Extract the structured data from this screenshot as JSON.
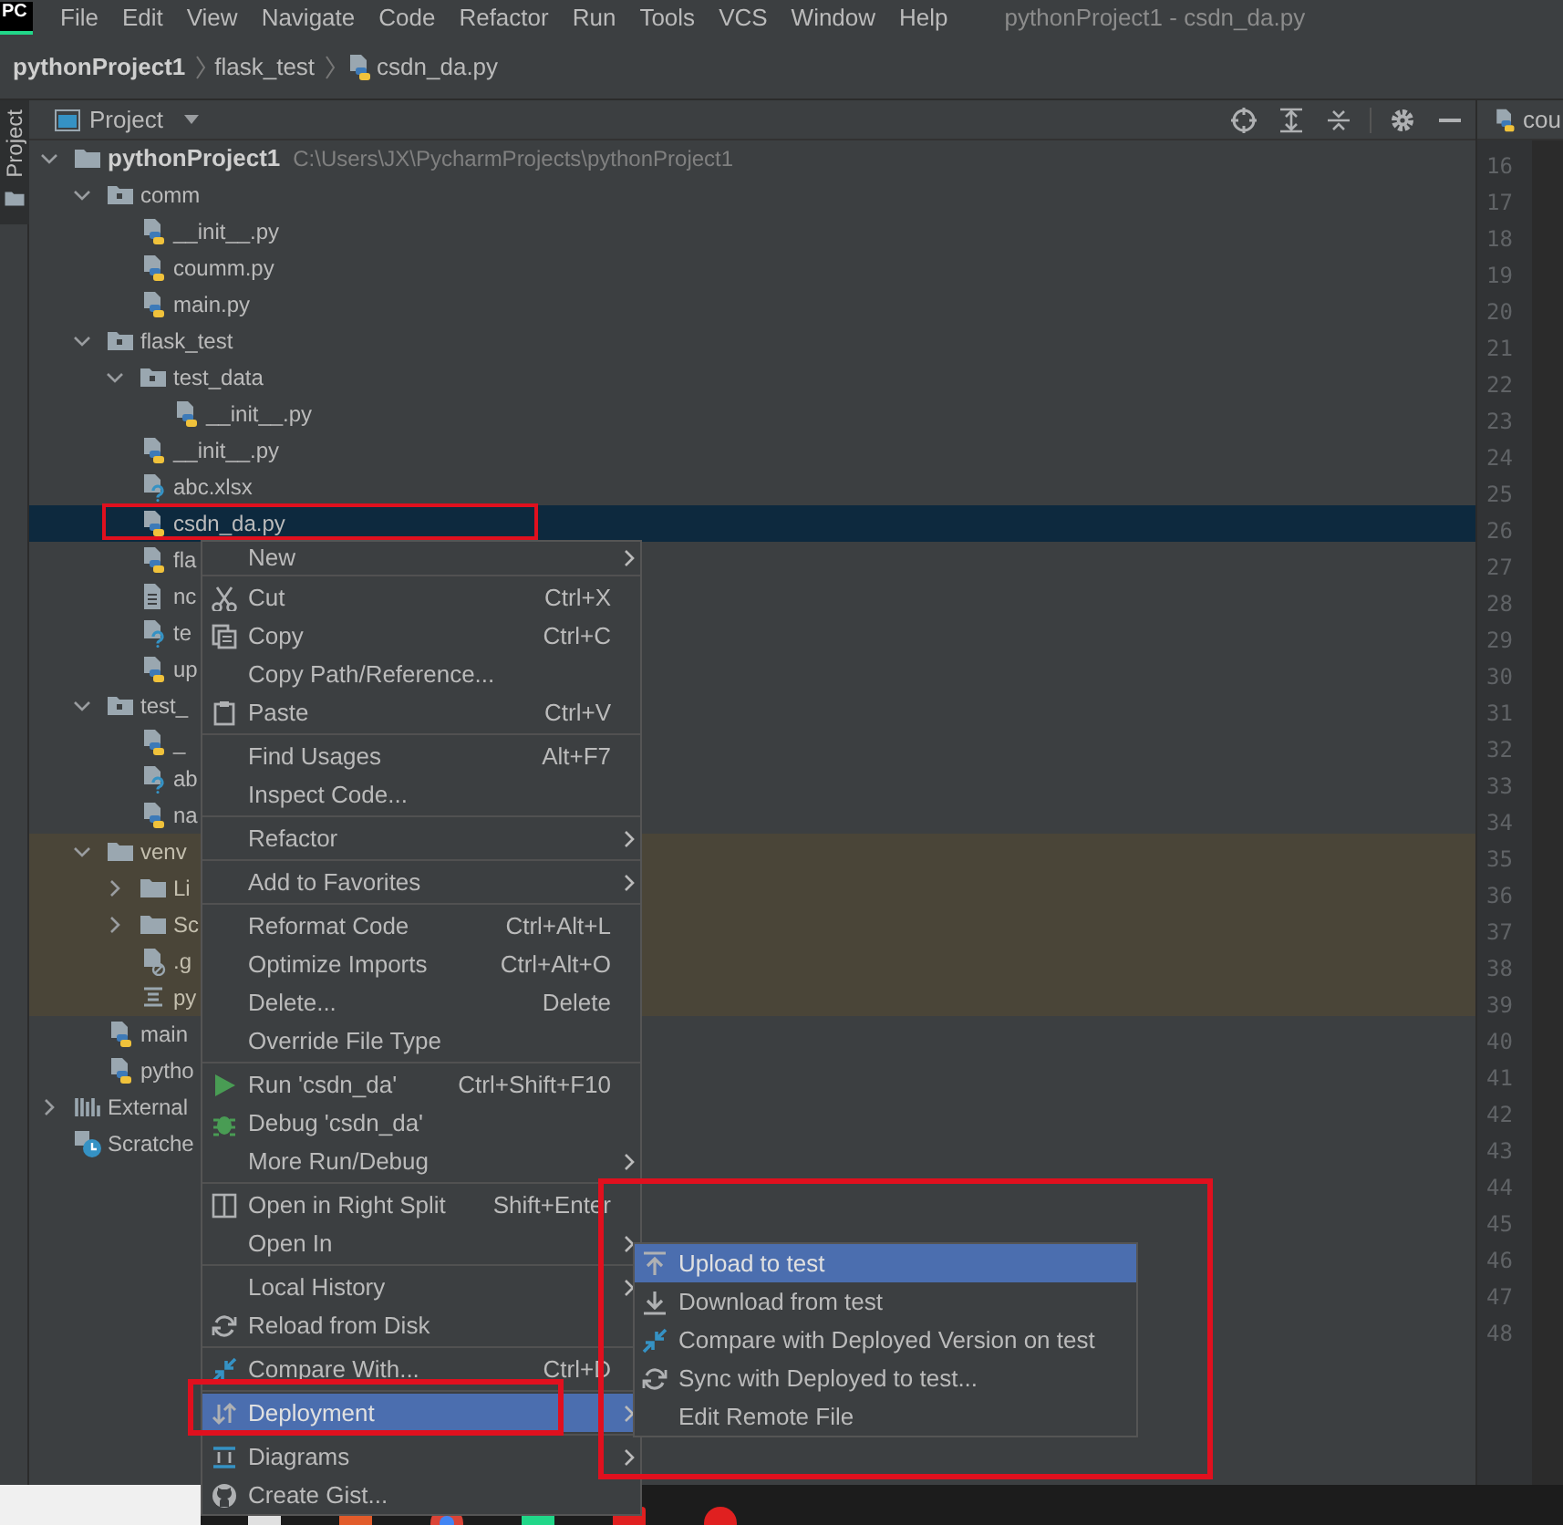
{
  "menu_bar": {
    "logo": "PC",
    "items": [
      "File",
      "Edit",
      "View",
      "Navigate",
      "Code",
      "Refactor",
      "Run",
      "Tools",
      "VCS",
      "Window",
      "Help"
    ],
    "title": "pythonProject1 - csdn_da.py"
  },
  "breadcrumbs": [
    {
      "label": "pythonProject1",
      "kind": "project"
    },
    {
      "label": "flask_test",
      "kind": "folder"
    },
    {
      "label": "csdn_da.py",
      "kind": "python"
    }
  ],
  "side_stripe": {
    "label": "Project",
    "selected": true
  },
  "project_panel": {
    "title": "Project",
    "tree": [
      {
        "label": "pythonProject1",
        "path": "C:\\Users\\JX\\PycharmProjects\\pythonProject1",
        "kind": "project",
        "expanded": true,
        "selected": false,
        "excluded": false,
        "children": [
          {
            "label": "comm",
            "kind": "package",
            "expanded": true,
            "selected": false,
            "excluded": false,
            "children": [
              {
                "label": "__init__.py",
                "kind": "python",
                "selected": false,
                "excluded": false
              },
              {
                "label": "coumm.py",
                "kind": "python",
                "selected": false,
                "excluded": false
              },
              {
                "label": "main.py",
                "kind": "python",
                "selected": false,
                "excluded": false
              }
            ]
          },
          {
            "label": "flask_test",
            "kind": "package",
            "expanded": true,
            "selected": false,
            "excluded": false,
            "children": [
              {
                "label": "test_data",
                "kind": "package",
                "expanded": true,
                "selected": false,
                "excluded": false,
                "children": [
                  {
                    "label": "__init__.py",
                    "kind": "python",
                    "selected": false,
                    "excluded": false
                  }
                ]
              },
              {
                "label": "__init__.py",
                "kind": "python",
                "selected": false,
                "excluded": false
              },
              {
                "label": "abc.xlsx",
                "kind": "unknown",
                "selected": false,
                "excluded": false
              },
              {
                "label": "csdn_da.py",
                "kind": "python",
                "selected": true,
                "excluded": false
              },
              {
                "label": "fla",
                "kind": "python",
                "selected": false,
                "excluded": false
              },
              {
                "label": "nc",
                "kind": "text",
                "selected": false,
                "excluded": false
              },
              {
                "label": "te",
                "kind": "unknown",
                "selected": false,
                "excluded": false
              },
              {
                "label": "up",
                "kind": "python",
                "selected": false,
                "excluded": false
              }
            ]
          },
          {
            "label": "test_",
            "kind": "package",
            "expanded": true,
            "selected": false,
            "excluded": false,
            "children": [
              {
                "label": "_",
                "kind": "python",
                "selected": false,
                "excluded": false
              },
              {
                "label": "ab",
                "kind": "unknown",
                "selected": false,
                "excluded": false
              },
              {
                "label": "na",
                "kind": "python",
                "selected": false,
                "excluded": false
              }
            ]
          },
          {
            "label": "venv",
            "kind": "folder",
            "expanded": true,
            "selected": false,
            "excluded": true,
            "children": [
              {
                "label": "Li",
                "kind": "folder",
                "expanded": false,
                "selected": false,
                "excluded": true
              },
              {
                "label": "Sc",
                "kind": "folder",
                "expanded": false,
                "selected": false,
                "excluded": true
              },
              {
                "label": ".g",
                "kind": "ignored",
                "selected": false,
                "excluded": true
              },
              {
                "label": "py",
                "kind": "config",
                "selected": false,
                "excluded": true
              }
            ]
          },
          {
            "label": "main",
            "kind": "python",
            "selected": false,
            "excluded": false
          },
          {
            "label": "pytho",
            "kind": "python",
            "selected": false,
            "excluded": false
          }
        ]
      },
      {
        "label": "External",
        "kind": "libraries",
        "expanded": false,
        "selected": false,
        "excluded": false
      },
      {
        "label": "Scratche",
        "kind": "scratches",
        "selected": false,
        "excluded": false
      }
    ]
  },
  "editor": {
    "tab": "cou",
    "line_numbers": [
      "16",
      "17",
      "18",
      "19",
      "20",
      "21",
      "22",
      "23",
      "24",
      "25",
      "26",
      "27",
      "28",
      "29",
      "30",
      "31",
      "32",
      "33",
      "34",
      "35",
      "36",
      "37",
      "38",
      "39",
      "40",
      "41",
      "42",
      "43",
      "44",
      "45",
      "46",
      "47",
      "48"
    ]
  },
  "context_menu": {
    "groups": [
      [
        {
          "label": "New",
          "submenu": true,
          "selected": false
        }
      ],
      [
        {
          "label": "Cut",
          "shortcut": "Ctrl+X",
          "submenu": false,
          "selected": false
        },
        {
          "label": "Copy",
          "shortcut": "Ctrl+C",
          "submenu": false,
          "selected": false
        },
        {
          "label": "Copy Path/Reference...",
          "submenu": false,
          "selected": false
        },
        {
          "label": "Paste",
          "shortcut": "Ctrl+V",
          "submenu": false,
          "selected": false
        }
      ],
      [
        {
          "label": "Find Usages",
          "shortcut": "Alt+F7",
          "submenu": false,
          "selected": false
        },
        {
          "label": "Inspect Code...",
          "submenu": false,
          "selected": false
        }
      ],
      [
        {
          "label": "Refactor",
          "submenu": true,
          "selected": false
        }
      ],
      [
        {
          "label": "Add to Favorites",
          "submenu": true,
          "selected": false
        }
      ],
      [
        {
          "label": "Reformat Code",
          "shortcut": "Ctrl+Alt+L",
          "submenu": false,
          "selected": false
        },
        {
          "label": "Optimize Imports",
          "shortcut": "Ctrl+Alt+O",
          "submenu": false,
          "selected": false
        },
        {
          "label": "Delete...",
          "shortcut": "Delete",
          "submenu": false,
          "selected": false
        },
        {
          "label": "Override File Type",
          "submenu": false,
          "selected": false
        }
      ],
      [
        {
          "label": "Run 'csdn_da'",
          "shortcut": "Ctrl+Shift+F10",
          "submenu": false,
          "selected": false
        },
        {
          "label": "Debug 'csdn_da'",
          "submenu": false,
          "selected": false
        },
        {
          "label": "More Run/Debug",
          "submenu": true,
          "selected": false
        }
      ],
      [
        {
          "label": "Open in Right Split",
          "shortcut": "Shift+Enter",
          "submenu": false,
          "selected": false
        },
        {
          "label": "Open In",
          "submenu": true,
          "selected": false
        }
      ],
      [
        {
          "label": "Local History",
          "submenu": true,
          "selected": false
        },
        {
          "label": "Reload from Disk",
          "submenu": false,
          "selected": false
        }
      ],
      [
        {
          "label": "Compare With...",
          "shortcut": "Ctrl+D",
          "submenu": false,
          "selected": false
        }
      ],
      [
        {
          "label": "Deployment",
          "submenu": true,
          "selected": true
        }
      ],
      [
        {
          "label": "Diagrams",
          "submenu": true,
          "selected": false
        },
        {
          "label": "Create Gist...",
          "submenu": false,
          "selected": false
        }
      ]
    ]
  },
  "submenu": {
    "items": [
      {
        "label": "Upload to test",
        "selected": true
      },
      {
        "label": "Download from test",
        "selected": false
      },
      {
        "label": "Compare with Deployed Version on test",
        "selected": false
      },
      {
        "label": "Sync with Deployed to test...",
        "selected": false
      },
      {
        "label": "Edit Remote File",
        "selected": false
      }
    ]
  },
  "annotation_boxes": [
    {
      "kind": "file"
    },
    {
      "kind": "item"
    },
    {
      "kind": "submenu"
    }
  ]
}
